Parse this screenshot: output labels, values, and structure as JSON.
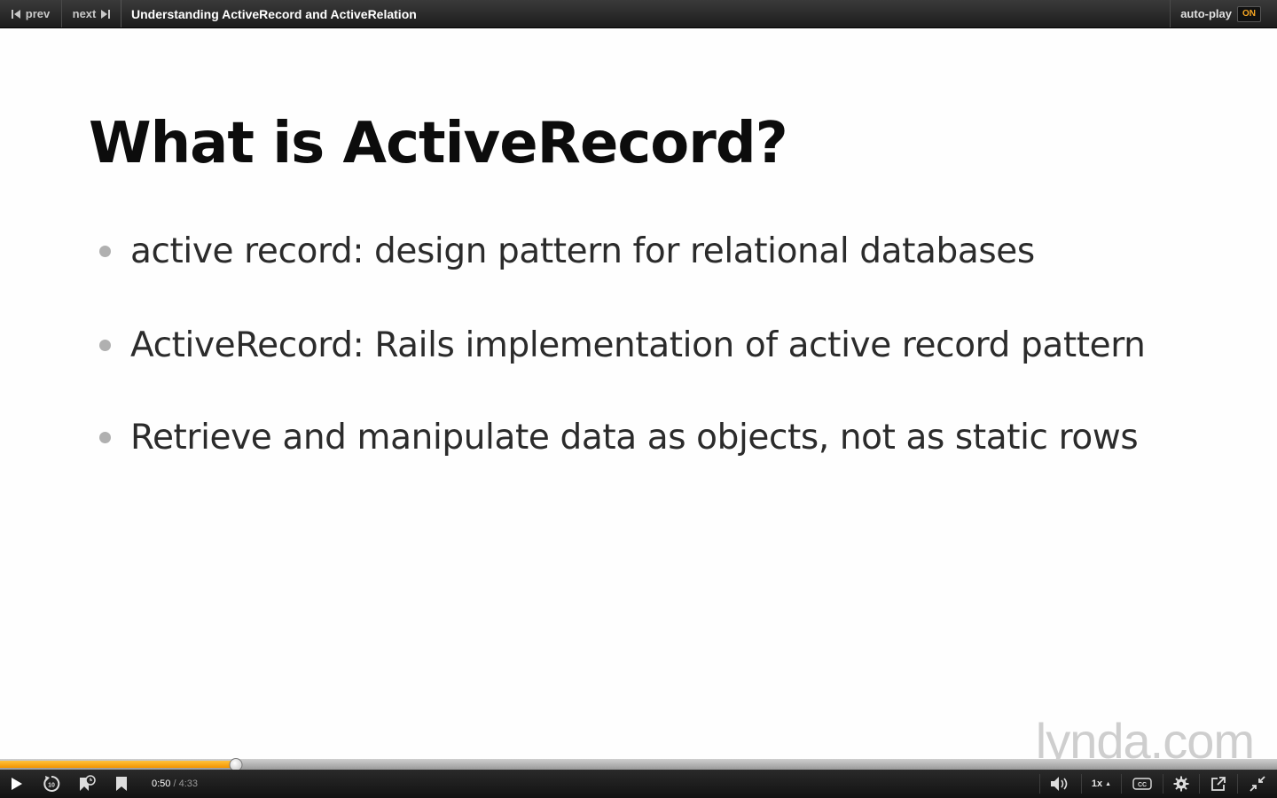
{
  "topbar": {
    "prev_label": "prev",
    "next_label": "next",
    "title": "Understanding ActiveRecord and ActiveRelation",
    "autoplay_label": "auto-play",
    "autoplay_state": "ON"
  },
  "slide": {
    "title": "What is ActiveRecord?",
    "bullets": [
      "active record: design pattern for relational databases",
      "ActiveRecord: Rails implementation of active record pattern",
      "Retrieve and manipulate data as objects, not as static rows"
    ],
    "watermark": "lynda.com"
  },
  "player": {
    "progress_fraction": 0.185,
    "current_time": "0:50",
    "separator": "/",
    "duration": "4:33",
    "speed": "1x",
    "icons": [
      "play-icon",
      "rewind-10-icon",
      "bookmark-time-icon",
      "bookmark-icon",
      "volume-icon",
      "cc-icon",
      "gear-icon",
      "popout-icon",
      "exit-fullscreen-icon"
    ]
  },
  "colors": {
    "accent": "#f29400",
    "bar_dark": "#1c1c1c"
  }
}
